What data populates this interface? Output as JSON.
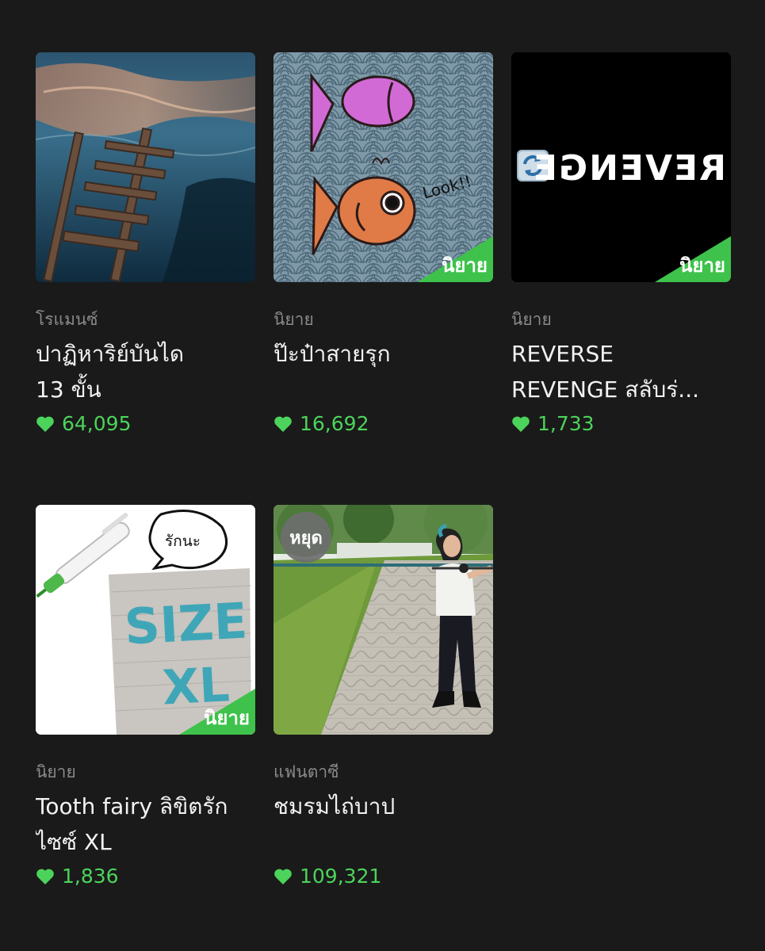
{
  "stories": [
    {
      "genre": "โรแมนซ์",
      "title": "ปาฏิหาริย์บันได\n13 ขั้น",
      "likes": "64,095",
      "heart_icon": "heart-icon",
      "cover_subject": "underwater-staircase"
    },
    {
      "genre": "นิยาย",
      "title": "ป๊ะป๋าสายรุก",
      "likes": "16,692",
      "badge": "นิยาย",
      "cover_text": "Look!!",
      "heart_icon": "heart-icon",
      "cover_subject": "two-fish"
    },
    {
      "genre": "นิยาย",
      "title": "REVERSE\nREVENGE สลับร่...",
      "likes": "1,733",
      "badge": "นิยาย",
      "cover_text": "REVENGE",
      "heart_icon": "heart-icon",
      "cover_subject": "mirrored-revenge"
    },
    {
      "genre": "นิยาย",
      "title": "Tooth fairy ลิขิตรัก\nไซซ์ XL",
      "likes": "1,836",
      "badge": "นิยาย",
      "cover_text": "รักนะ",
      "cover_text_2": "SIZE",
      "cover_text_3": "XL",
      "heart_icon": "heart-icon",
      "cover_subject": "knitted-size-tag"
    },
    {
      "genre": "แฟนตาซี",
      "title": "ชมรมไถ่บาป",
      "likes": "109,321",
      "status": "หยุด",
      "heart_icon": "heart-icon",
      "cover_subject": "girl-with-sword"
    }
  ],
  "colors": {
    "background": "#1a1a1a",
    "accent": "#3ec24b",
    "likes": "#4cd35b",
    "genre": "#8a8a8a",
    "title": "#f2f2f2"
  }
}
